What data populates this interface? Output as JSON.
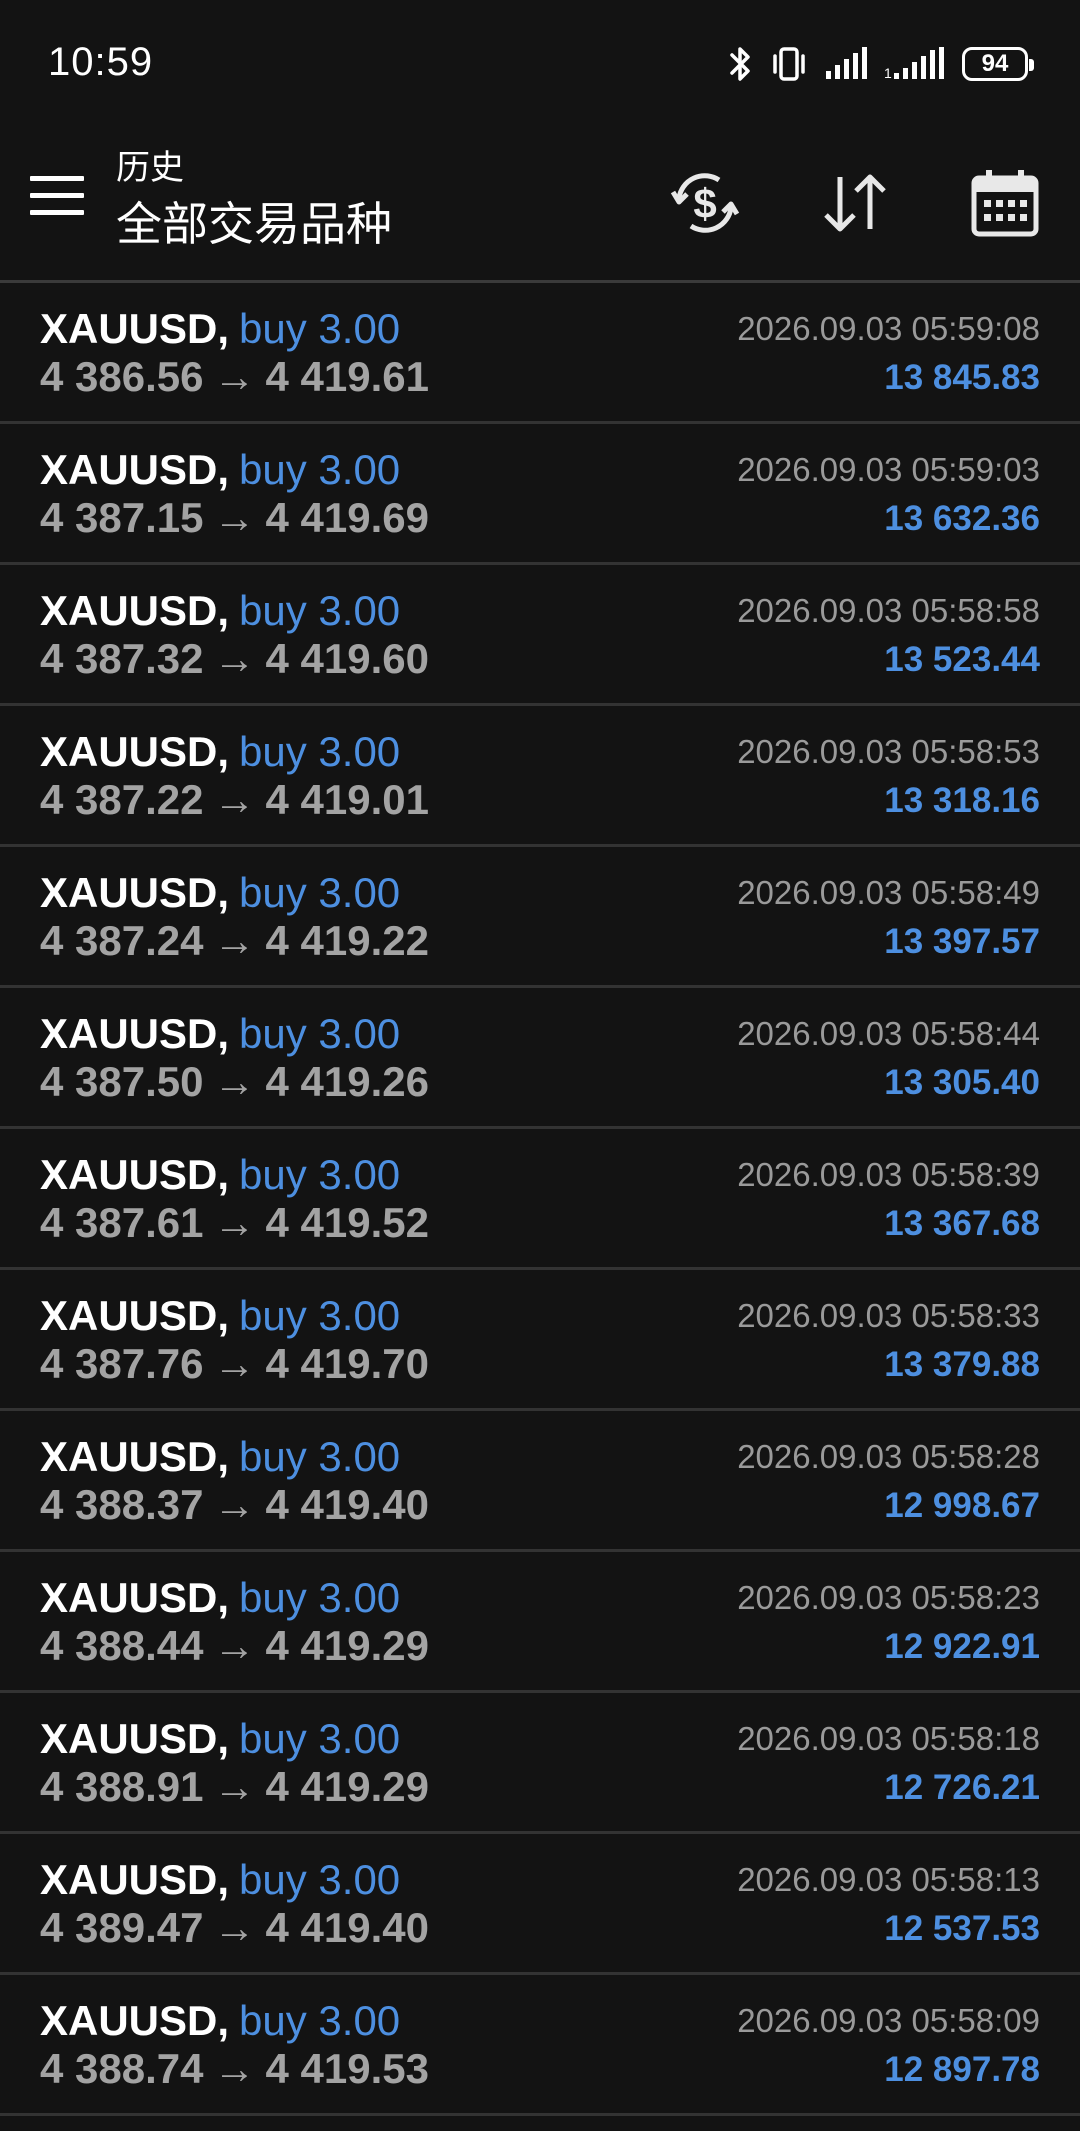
{
  "status_bar": {
    "time": "10:59",
    "battery": "94",
    "icons": [
      "bluetooth-icon",
      "vibrate-icon",
      "signal-icon",
      "signal-icon"
    ]
  },
  "toolbar": {
    "subtitle": "历史",
    "title": "全部交易品种",
    "icons": [
      "menu-icon",
      "currency-refresh-icon",
      "sort-icon",
      "calendar-icon"
    ]
  },
  "colors": {
    "background": "#131313",
    "accent_blue": "#4d8fe0",
    "price_gray": "#a3a3a3",
    "divider": "#333333"
  },
  "deals": [
    {
      "symbol": "XAUUSD,",
      "type": "buy 3.00",
      "open": "4 386.56",
      "arrow": "→",
      "close": "4 419.61",
      "time": "2026.09.03 05:59:08",
      "profit": "13 845.83"
    },
    {
      "symbol": "XAUUSD,",
      "type": "buy 3.00",
      "open": "4 387.15",
      "arrow": "→",
      "close": "4 419.69",
      "time": "2026.09.03 05:59:03",
      "profit": "13 632.36"
    },
    {
      "symbol": "XAUUSD,",
      "type": "buy 3.00",
      "open": "4 387.32",
      "arrow": "→",
      "close": "4 419.60",
      "time": "2026.09.03 05:58:58",
      "profit": "13 523.44"
    },
    {
      "symbol": "XAUUSD,",
      "type": "buy 3.00",
      "open": "4 387.22",
      "arrow": "→",
      "close": "4 419.01",
      "time": "2026.09.03 05:58:53",
      "profit": "13 318.16"
    },
    {
      "symbol": "XAUUSD,",
      "type": "buy 3.00",
      "open": "4 387.24",
      "arrow": "→",
      "close": "4 419.22",
      "time": "2026.09.03 05:58:49",
      "profit": "13 397.57"
    },
    {
      "symbol": "XAUUSD,",
      "type": "buy 3.00",
      "open": "4 387.50",
      "arrow": "→",
      "close": "4 419.26",
      "time": "2026.09.03 05:58:44",
      "profit": "13 305.40"
    },
    {
      "symbol": "XAUUSD,",
      "type": "buy 3.00",
      "open": "4 387.61",
      "arrow": "→",
      "close": "4 419.52",
      "time": "2026.09.03 05:58:39",
      "profit": "13 367.68"
    },
    {
      "symbol": "XAUUSD,",
      "type": "buy 3.00",
      "open": "4 387.76",
      "arrow": "→",
      "close": "4 419.70",
      "time": "2026.09.03 05:58:33",
      "profit": "13 379.88"
    },
    {
      "symbol": "XAUUSD,",
      "type": "buy 3.00",
      "open": "4 388.37",
      "arrow": "→",
      "close": "4 419.40",
      "time": "2026.09.03 05:58:28",
      "profit": "12 998.67"
    },
    {
      "symbol": "XAUUSD,",
      "type": "buy 3.00",
      "open": "4 388.44",
      "arrow": "→",
      "close": "4 419.29",
      "time": "2026.09.03 05:58:23",
      "profit": "12 922.91"
    },
    {
      "symbol": "XAUUSD,",
      "type": "buy 3.00",
      "open": "4 388.91",
      "arrow": "→",
      "close": "4 419.29",
      "time": "2026.09.03 05:58:18",
      "profit": "12 726.21"
    },
    {
      "symbol": "XAUUSD,",
      "type": "buy 3.00",
      "open": "4 389.47",
      "arrow": "→",
      "close": "4 419.40",
      "time": "2026.09.03 05:58:13",
      "profit": "12 537.53"
    },
    {
      "symbol": "XAUUSD,",
      "type": "buy 3.00",
      "open": "4 388.74",
      "arrow": "→",
      "close": "4 419.53",
      "time": "2026.09.03 05:58:09",
      "profit": "12 897.78"
    }
  ]
}
